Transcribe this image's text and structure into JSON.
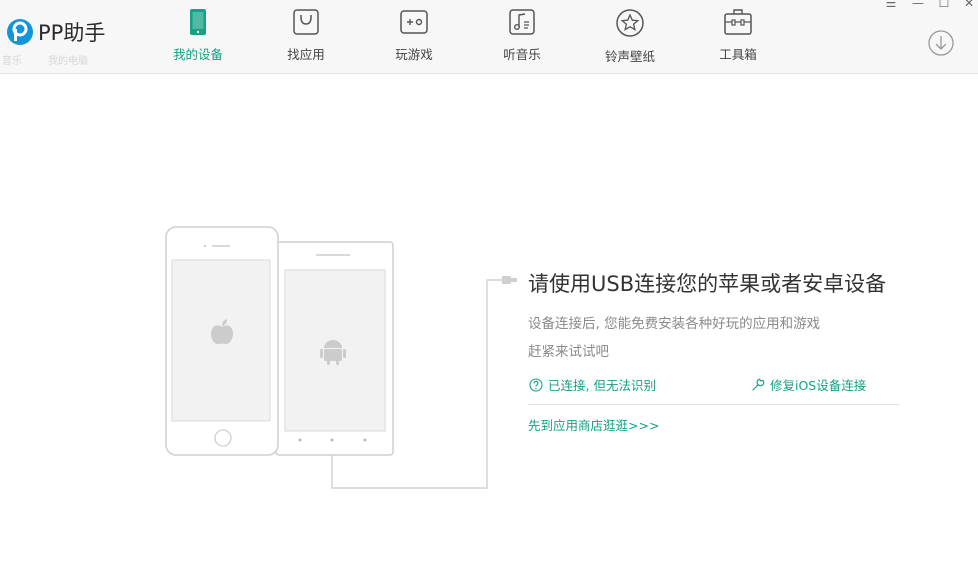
{
  "app": {
    "logo_text": "PP助手",
    "brand_color": "#16a085"
  },
  "background_labels": [
    "音乐",
    "我的电脑"
  ],
  "nav": [
    {
      "label": "我的设备",
      "icon": "phone-icon",
      "active": true
    },
    {
      "label": "找应用",
      "icon": "shopping-bag-icon",
      "active": false
    },
    {
      "label": "玩游戏",
      "icon": "gamepad-icon",
      "active": false
    },
    {
      "label": "听音乐",
      "icon": "music-note-icon",
      "active": false
    },
    {
      "label": "铃声壁纸",
      "icon": "star-icon",
      "active": false
    },
    {
      "label": "工具箱",
      "icon": "toolbox-icon",
      "active": false
    }
  ],
  "window_controls": {
    "menu": "☰",
    "minimize": "—",
    "maximize": "☐",
    "close": "✕"
  },
  "main": {
    "headline": "请使用USB连接您的苹果或者安卓设备",
    "desc_line1": "设备连接后, 您能免费安装各种好玩的应用和游戏",
    "desc_line2": "赶紧来试试吧",
    "link_connected": "已连接, 但无法识别",
    "link_repair": "修复iOS设备连接",
    "link_store": "先到应用商店逛逛>>>"
  }
}
